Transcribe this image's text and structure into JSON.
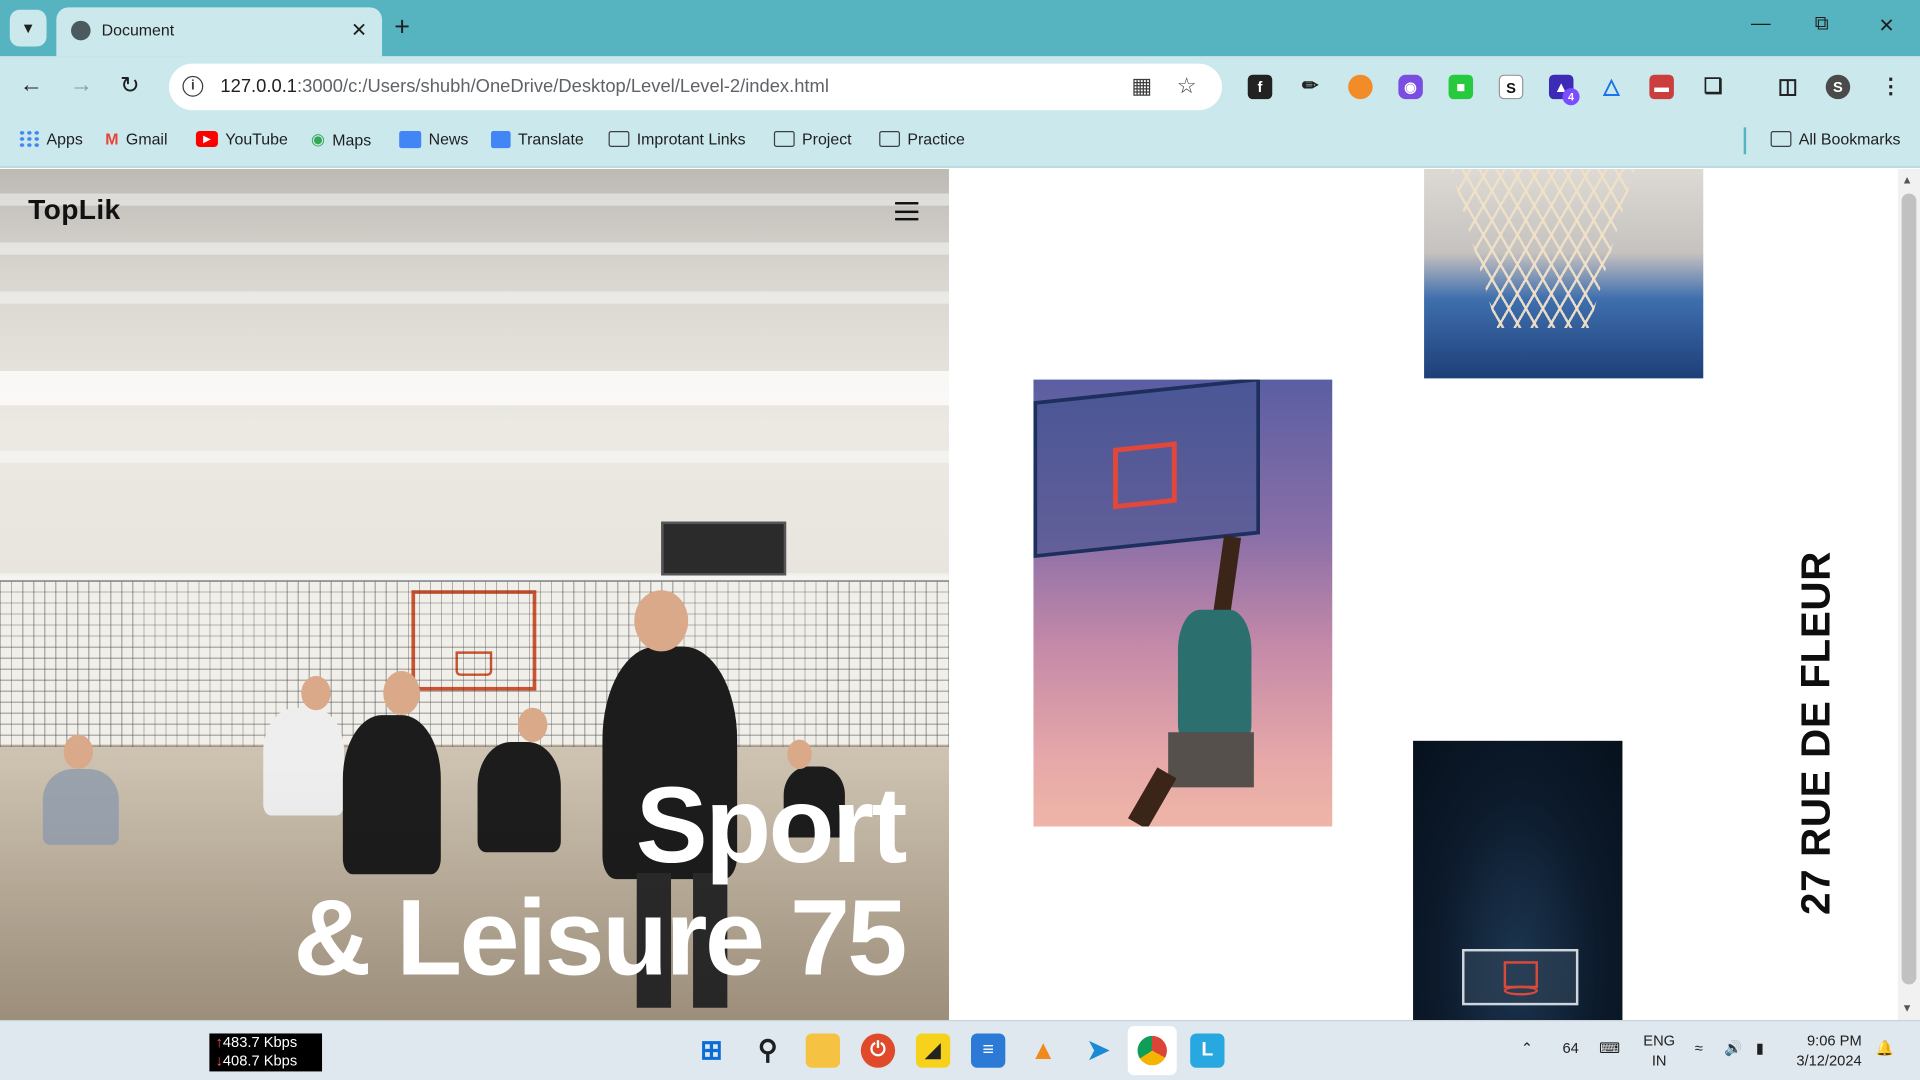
{
  "browser": {
    "tab_title": "Document",
    "url_host": "127.0.0.1",
    "url_rest": ":3000/c:/Users/shubh/OneDrive/Desktop/Level/Level-2/index.html",
    "profile_initial": "S"
  },
  "bookmarks": [
    {
      "label": "Apps",
      "icon": "apps-grid-icon"
    },
    {
      "label": "Gmail",
      "icon": "gmail-icon"
    },
    {
      "label": "YouTube",
      "icon": "youtube-icon"
    },
    {
      "label": "Maps",
      "icon": "maps-pin-icon"
    },
    {
      "label": "News",
      "icon": "news-icon"
    },
    {
      "label": "Translate",
      "icon": "translate-icon"
    },
    {
      "label": "Improtant Links",
      "icon": "folder-icon"
    },
    {
      "label": "Project",
      "icon": "folder-icon"
    },
    {
      "label": "Practice",
      "icon": "folder-icon"
    }
  ],
  "all_bookmarks": "All Bookmarks",
  "page": {
    "logo": "TopLik",
    "headline_line1": "Sport",
    "headline_line2": "& Leisure 75",
    "vertical_text": "27 RUE DE FLEUR"
  },
  "taskbar": {
    "net_up": "483.7 Kbps",
    "net_down": "408.7 Kbps",
    "tray_number": "64",
    "lang_top": "ENG",
    "lang_bottom": "IN",
    "time": "9:06 PM",
    "date": "3/12/2024",
    "extension_badge": "4"
  },
  "colors": {
    "tabstrip": "#56b4c1",
    "toolbar": "#cbe8ec",
    "accent_red": "#e3473a"
  }
}
